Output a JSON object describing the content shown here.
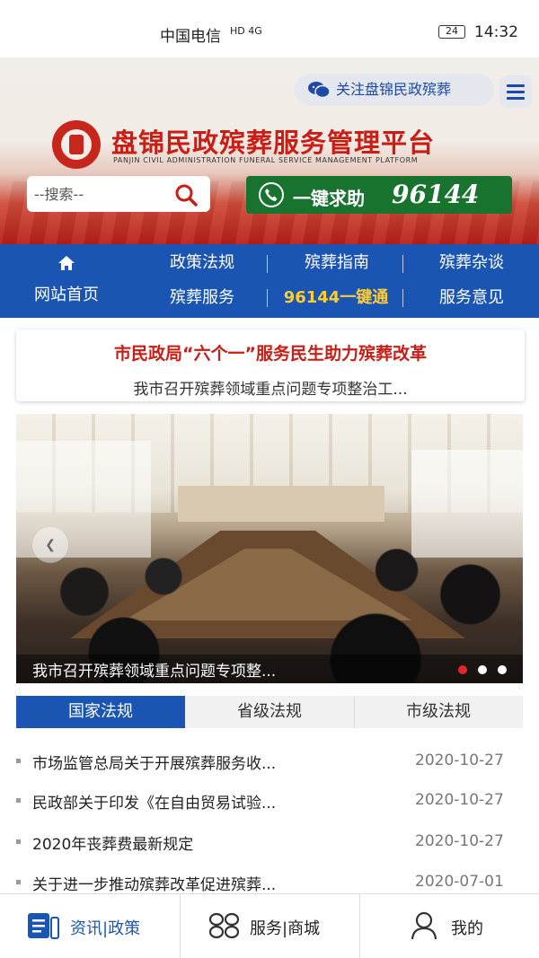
{
  "status_bar": {
    "carrier": "中国电信",
    "network": "HD 4G",
    "battery": "24",
    "time": "14:32"
  },
  "header": {
    "follow_label": "关注盘锦民政殡葬",
    "title": "盘锦民政殡葬服务管理平台",
    "subtitle": "PANJIN CIVIL ADMINISTRATION FUNERAL SERVICE MANAGEMENT PLATFORM",
    "search_placeholder": "--搜索--",
    "help_label": "一键求助",
    "help_number": "96144"
  },
  "nav": {
    "home": "网站首页",
    "items": [
      "政策法规",
      "殡葬指南",
      "殡葬杂谈",
      "殡葬服务",
      "96144一键通",
      "服务意见"
    ]
  },
  "headline": {
    "title": "市民政局“六个一”服务民生助力殡葬改革",
    "subtitle": "我市召开殡葬领域重点问题专项整治工..."
  },
  "carousel": {
    "caption": "我市召开殡葬领域重点问题专项整...",
    "prev_symbol": "❮",
    "slides": 3,
    "active_slide": 1
  },
  "tabs": [
    "国家法规",
    "省级法规",
    "市级法规"
  ],
  "news": [
    {
      "title": "市场监管总局关于开展殡葬服务收...",
      "date": "2020-10-27"
    },
    {
      "title": "民政部关于印发《在自由贸易试验...",
      "date": "2020-10-27"
    },
    {
      "title": "2020年丧葬费最新规定",
      "date": "2020-10-27"
    },
    {
      "title": "关于进一步推动殡葬改革促进殡葬...",
      "date": "2020-07-01"
    }
  ],
  "bottom_tabs": [
    "资讯|政策",
    "服务|商城",
    "我的"
  ],
  "colors": {
    "brand_blue": "#1b55b3",
    "brand_red": "#c81e16",
    "help_green": "#18732f",
    "hotline_yellow": "#ffcc33"
  }
}
